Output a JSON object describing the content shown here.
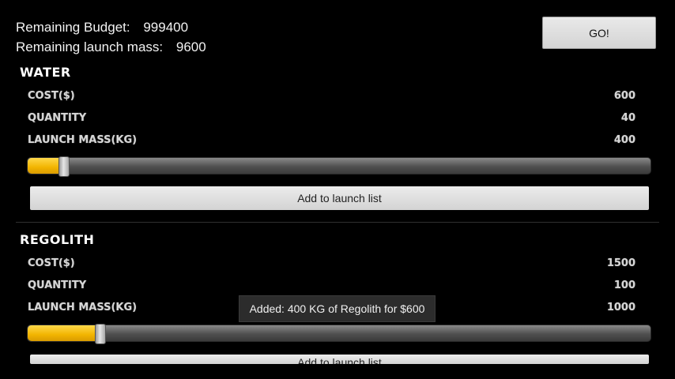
{
  "summary": {
    "budget_label": "Remaining Budget:",
    "budget_value": "999400",
    "mass_label": "Remaining launch mass:",
    "mass_value": "9600"
  },
  "go_button": {
    "label": "GO!"
  },
  "items": [
    {
      "title": "WATER",
      "cost_label": "COST($)",
      "cost_value": "600",
      "quantity_label": "QUANTITY",
      "quantity_value": "40",
      "mass_label": "LAUNCH MASS(KG)",
      "mass_value": "400",
      "slider_fraction": 0.05,
      "add_label": "Add to launch list"
    },
    {
      "title": "REGOLITH",
      "cost_label": "COST($)",
      "cost_value": "1500",
      "quantity_label": "QUANTITY",
      "quantity_value": "100",
      "mass_label": "LAUNCH MASS(KG)",
      "mass_value": "1000",
      "slider_fraction": 0.11,
      "add_label": "Add to launch list"
    }
  ],
  "toast": {
    "message": "Added: 400 KG of Regolith for $600"
  },
  "colors": {
    "slider_fill": "#f2b400",
    "background": "#000000"
  }
}
